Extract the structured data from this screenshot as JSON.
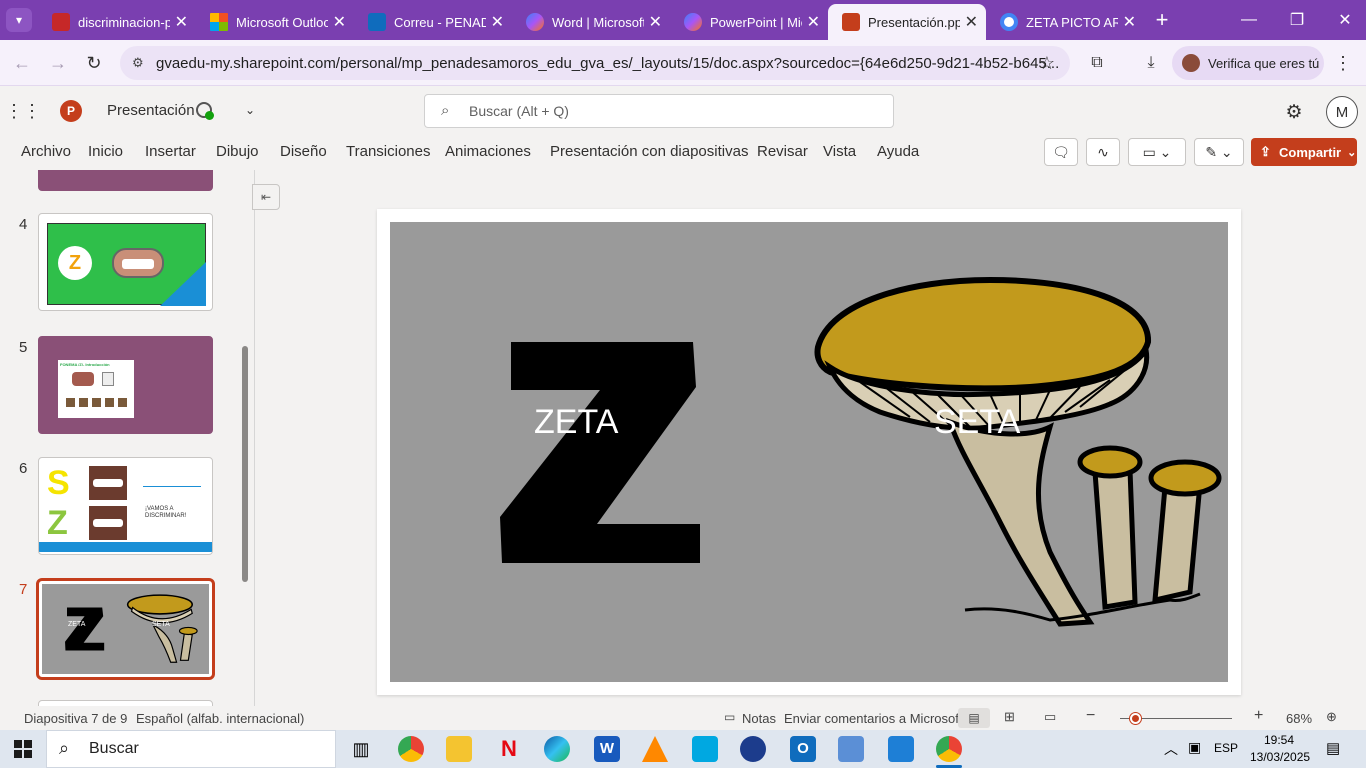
{
  "browser": {
    "tabs": [
      {
        "title": "discriminacion-p",
        "icon": "pdf-icon",
        "color": "#c62828"
      },
      {
        "title": "Microsoft Outloo",
        "icon": "microsoft-icon",
        "color": "#f25022"
      },
      {
        "title": "Correu - PENAD",
        "icon": "outlook-icon",
        "color": "#0f6cbd"
      },
      {
        "title": "Word | Microsoft",
        "icon": "copilot-icon",
        "color": "#5a4fcf"
      },
      {
        "title": "PowerPoint | Mic",
        "icon": "copilot-icon",
        "color": "#5a4fcf"
      },
      {
        "title": "Presentación.ppt",
        "icon": "powerpoint-icon",
        "color": "#c43e1c"
      },
      {
        "title": "ZETA PICTO ARA",
        "icon": "google-icon",
        "color": "#4285f4"
      }
    ],
    "url": "gvaedu-my.sharepoint.com/personal/mp_penadesamoros_edu_gva_es/_layouts/15/doc.aspx?sourcedoc={64e6d250-9d21-4b52-b645...",
    "verify_label": "Verifica que eres tú"
  },
  "office": {
    "doc_title": "Presentación",
    "search_placeholder": "Buscar (Alt + Q)",
    "avatar": "M",
    "ribbon_tabs": [
      "Archivo",
      "Inicio",
      "Insertar",
      "Dibujo",
      "Diseño",
      "Transiciones",
      "Animaciones",
      "Presentación con diapositivas",
      "Revisar",
      "Vista",
      "Ayuda"
    ],
    "share_label": "Compartir"
  },
  "thumbnails": {
    "numbers": [
      "4",
      "5",
      "6",
      "7"
    ],
    "s5_title": "FONEMA /Z/- Introducción",
    "s6_text": "¡VAMOS A DISCRIMINAR!",
    "s6_letters": [
      "S",
      "Z"
    ],
    "s7_labels": [
      "ZETA",
      "SETA"
    ]
  },
  "slide": {
    "label_left": "ZETA",
    "label_right": "SETA",
    "background": "#9a9a9a"
  },
  "status": {
    "slide_info": "Diapositiva 7 de 9",
    "language": "Español (alfab. internacional)",
    "notes": "Notas",
    "feedback": "Enviar comentarios a Microsoft",
    "zoom": "68%"
  },
  "taskbar": {
    "search": "Buscar",
    "lang": "ESP",
    "time": "19:54",
    "date": "13/03/2025"
  }
}
